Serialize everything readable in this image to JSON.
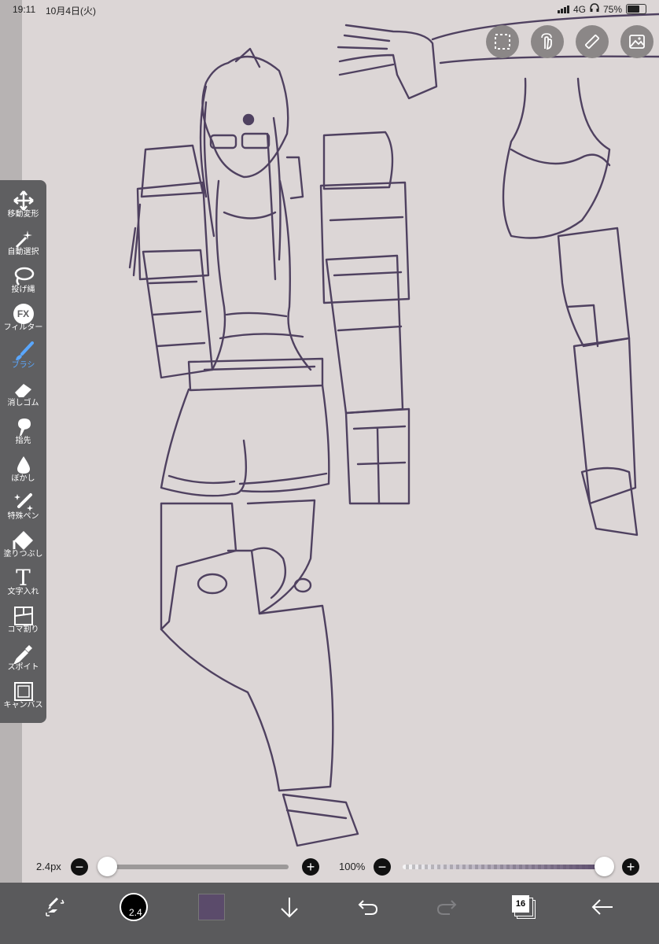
{
  "status_bar": {
    "time": "19:11",
    "date": "10月4日(火)",
    "network": "4G",
    "battery": "75%",
    "battery_level": 0.75
  },
  "top_buttons": [
    {
      "name": "selection-icon"
    },
    {
      "name": "gesture-icon"
    },
    {
      "name": "ruler-icon"
    },
    {
      "name": "material-icon"
    }
  ],
  "tools": [
    {
      "name": "move-transform",
      "label": "移動変形",
      "icon": "move-arrows-icon"
    },
    {
      "name": "auto-select",
      "label": "自動選択",
      "icon": "magic-wand-icon"
    },
    {
      "name": "lasso",
      "label": "投げ縄",
      "icon": "lasso-icon"
    },
    {
      "name": "filter",
      "label": "フィルター",
      "icon": "fx-icon",
      "icon_text": "FX"
    },
    {
      "name": "brush",
      "label": "ブラシ",
      "icon": "brush-icon",
      "active": true
    },
    {
      "name": "eraser",
      "label": "消しゴム",
      "icon": "eraser-icon"
    },
    {
      "name": "smudge",
      "label": "指先",
      "icon": "finger-icon"
    },
    {
      "name": "blur",
      "label": "ぼかし",
      "icon": "droplet-icon"
    },
    {
      "name": "special-pen",
      "label": "特殊ペン",
      "icon": "sparkle-pen-icon"
    },
    {
      "name": "fill",
      "label": "塗りつぶし",
      "icon": "bucket-icon"
    },
    {
      "name": "text",
      "label": "文字入れ",
      "icon": "text-icon",
      "icon_text": "T"
    },
    {
      "name": "panel",
      "label": "コマ割り",
      "icon": "panel-icon"
    },
    {
      "name": "eyedropper",
      "label": "スポイト",
      "icon": "eyedropper-icon"
    },
    {
      "name": "canvas",
      "label": "キャンバス",
      "icon": "canvas-icon"
    }
  ],
  "brush_size": {
    "value_label": "2.4px",
    "level": 0.0,
    "minus": "−",
    "plus": "+"
  },
  "opacity": {
    "value_label": "100%",
    "level": 1.0,
    "minus": "−",
    "plus": "+"
  },
  "bottom_bar": {
    "brush_size_badge": "2.4",
    "layer_count": "16",
    "current_color": "#5b4b6b"
  },
  "colors": {
    "canvas": "#dcd6d6",
    "toolbar": "#5f5f61",
    "active_tool": "#5aa7ff",
    "line_art": "#4f4160"
  }
}
